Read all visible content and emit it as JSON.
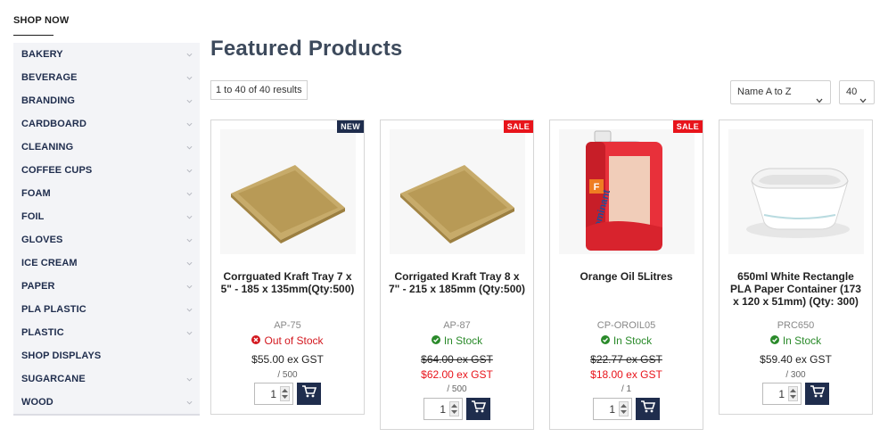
{
  "sidebar": {
    "heading": "SHOP NOW",
    "items": [
      {
        "label": "BAKERY",
        "has_children": true
      },
      {
        "label": "BEVERAGE",
        "has_children": true
      },
      {
        "label": "BRANDING",
        "has_children": true
      },
      {
        "label": "CARDBOARD",
        "has_children": true
      },
      {
        "label": "CLEANING",
        "has_children": true
      },
      {
        "label": "COFFEE CUPS",
        "has_children": true
      },
      {
        "label": "FOAM",
        "has_children": true
      },
      {
        "label": "FOIL",
        "has_children": true
      },
      {
        "label": "GLOVES",
        "has_children": true
      },
      {
        "label": "ICE CREAM",
        "has_children": true
      },
      {
        "label": "PAPER",
        "has_children": true
      },
      {
        "label": "PLA PLASTIC",
        "has_children": true
      },
      {
        "label": "PLASTIC",
        "has_children": true
      },
      {
        "label": "SHOP DISPLAYS",
        "has_children": false
      },
      {
        "label": "SUGARCANE",
        "has_children": true
      },
      {
        "label": "WOOD",
        "has_children": true
      }
    ]
  },
  "main": {
    "title": "Featured Products",
    "results_text": "1 to 40 of 40 results",
    "sort": {
      "selected": "Name A to Z"
    },
    "per_page": {
      "selected": "40"
    }
  },
  "products": [
    {
      "badge": "NEW",
      "name": "Corrguated Kraft Tray 7 x 5\" - 185 x 135mm(Qty:500)",
      "sku": "AP-75",
      "stock": "Out of Stock",
      "price": "$55.00 ex GST",
      "unit": "/ 500",
      "qty": "1"
    },
    {
      "badge": "SALE",
      "name": "Corrigated Kraft Tray 8 x 7\" - 215 x 185mm (Qty:500)",
      "sku": "AP-87",
      "stock": "In Stock",
      "old_price": "$64.00 ex GST",
      "price": "$62.00 ex GST",
      "unit": "/ 500",
      "qty": "1"
    },
    {
      "badge": "SALE",
      "name": "Orange Oil 5Litres",
      "sku": "CP-OROIL05",
      "stock": "In Stock",
      "old_price": "$22.77 ex GST",
      "price": "$18.00 ex GST",
      "unit": "/ 1",
      "qty": "1",
      "bottle_label": "Dominant",
      "bottle_letter": "F"
    },
    {
      "name": "650ml White Rectangle PLA Paper Container (173 x 120 x 51mm) (Qty: 300)",
      "sku": "PRC650",
      "stock": "In Stock",
      "price": "$59.40 ex GST",
      "unit": "/ 300",
      "qty": "1"
    }
  ],
  "colors": {
    "brand_navy": "#1f2d4d",
    "sale_red": "#e8141b",
    "in_stock_green": "#2a8a2a",
    "out_of_stock_red": "#d3181f",
    "sidebar_bg": "#f3f4f7"
  }
}
